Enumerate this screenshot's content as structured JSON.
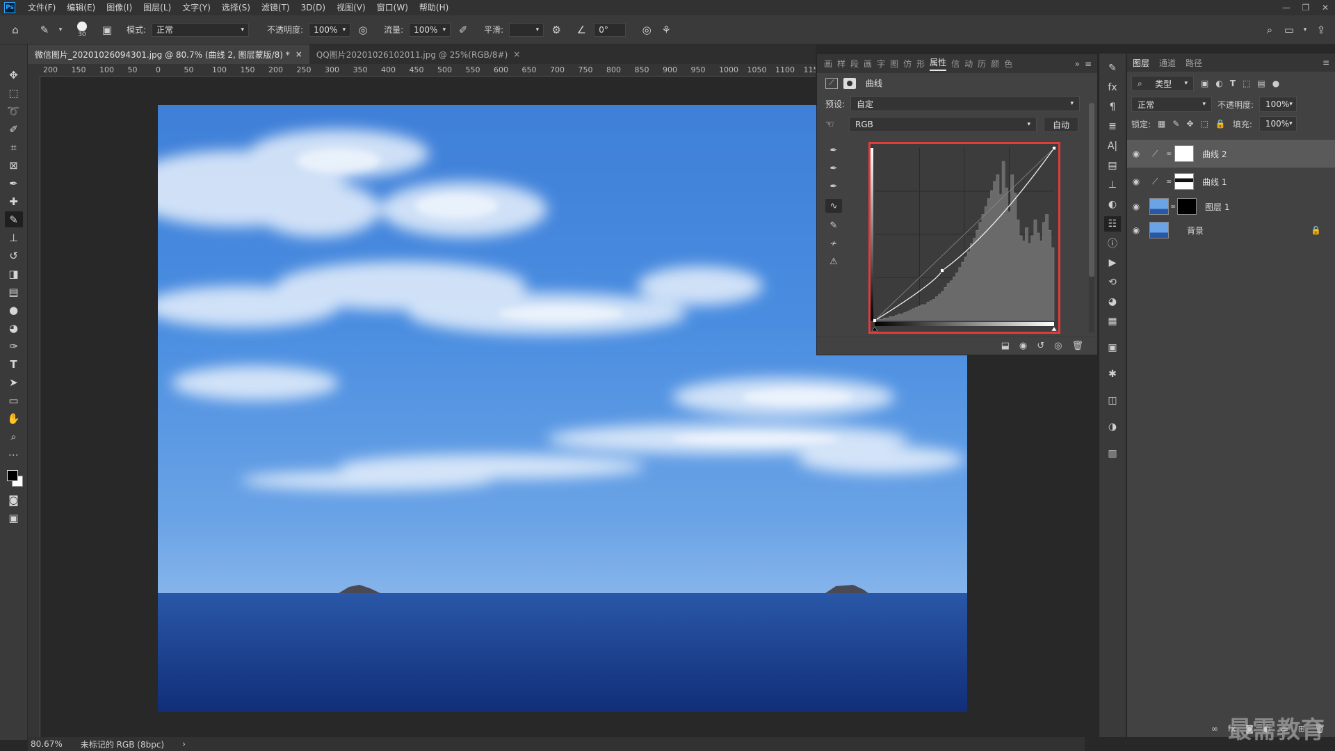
{
  "menubar": {
    "logo": "Ps",
    "items": [
      "文件(F)",
      "编辑(E)",
      "图像(I)",
      "图层(L)",
      "文字(Y)",
      "选择(S)",
      "滤镜(T)",
      "3D(D)",
      "视图(V)",
      "窗口(W)",
      "帮助(H)"
    ],
    "window_controls": [
      "—",
      "❐",
      "✕"
    ]
  },
  "options": {
    "brush_size": "30",
    "mode_label": "模式:",
    "mode_value": "正常",
    "opacity_label": "不透明度:",
    "opacity_value": "100%",
    "flow_label": "流量:",
    "flow_value": "100%",
    "smooth_label": "平滑:",
    "smooth_value": "",
    "angle_value": "0°"
  },
  "tabs": [
    {
      "label": "微信图片_20201026094301.jpg @ 80.7% (曲线 2, 图层蒙版/8) *",
      "close": "×"
    },
    {
      "label": "QQ图片20201026102011.jpg @ 25%(RGB/8#)",
      "close": "×"
    }
  ],
  "hruler": [
    "200",
    "150",
    "100",
    "50",
    "0",
    "50",
    "100",
    "150",
    "200",
    "250",
    "300",
    "350",
    "400",
    "450",
    "500",
    "550",
    "600",
    "650",
    "700",
    "750",
    "800",
    "850",
    "900",
    "950",
    "1000",
    "1050",
    "1100",
    "115"
  ],
  "status": {
    "zoom": "80.67%",
    "doc_info": "未标记的 RGB (8bpc)",
    "arrow": "›"
  },
  "properties": {
    "tabs": [
      "画",
      "样",
      "段",
      "画",
      "字",
      "图",
      "仿",
      "形",
      "属性",
      "信",
      "动",
      "历",
      "颜",
      "色"
    ],
    "active_tab": "属性",
    "title": "曲线",
    "preset_label": "预设:",
    "preset_value": "自定",
    "channel_value": "RGB",
    "auto_label": "自动"
  },
  "curve": {
    "points": [
      [
        0,
        0
      ],
      [
        96,
        74
      ],
      [
        255,
        255
      ]
    ],
    "histogram": [
      0,
      1,
      1,
      2,
      2,
      3,
      3,
      4,
      5,
      5,
      6,
      7,
      8,
      9,
      10,
      11,
      12,
      12,
      14,
      15,
      16,
      18,
      20,
      22,
      25,
      28,
      30,
      33,
      36,
      40,
      44,
      48,
      52,
      58,
      62,
      68,
      74,
      80,
      86,
      92,
      98,
      105,
      110,
      95,
      120,
      100,
      82,
      110,
      96,
      76,
      64,
      60,
      70,
      58,
      64,
      76,
      66,
      60,
      74,
      80,
      68,
      55
    ]
  },
  "layers": {
    "tabs": [
      "图层",
      "通道",
      "路径"
    ],
    "active_tab": "图层",
    "filter_label": "类型",
    "blend_value": "正常",
    "opacity_label": "不透明度:",
    "opacity_value": "100%",
    "lock_label": "锁定:",
    "fill_label": "填充:",
    "fill_value": "100%",
    "items": [
      {
        "name": "曲线 2",
        "selected": true
      },
      {
        "name": "曲线 1",
        "selected": false
      },
      {
        "name": "图层 1",
        "selected": false
      },
      {
        "name": "背景",
        "selected": false
      }
    ]
  },
  "watermark": "最需教育",
  "colors": {
    "accent_red": "#e23b3b",
    "sky_top": "#2f6fd0",
    "sea": "#1b3f8f"
  }
}
